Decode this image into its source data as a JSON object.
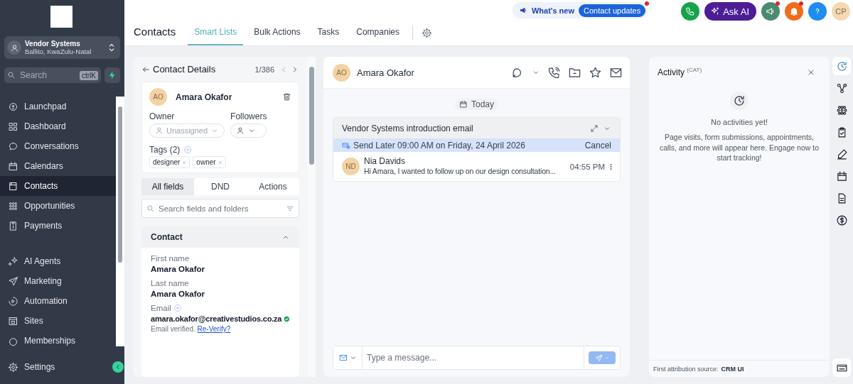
{
  "sidebar": {
    "account": {
      "name": "Vendor Systems",
      "location": "Ballito, KwaZulu-Natal"
    },
    "search": {
      "placeholder": "Search",
      "shortcut": "ctrlK"
    },
    "nav_groups": [
      [
        {
          "label": "Launchpad",
          "selected": false
        },
        {
          "label": "Dashboard",
          "selected": false
        },
        {
          "label": "Conversations",
          "selected": false
        },
        {
          "label": "Calendars",
          "selected": false
        },
        {
          "label": "Contacts",
          "selected": true
        },
        {
          "label": "Opportunities",
          "selected": false
        },
        {
          "label": "Payments",
          "selected": false
        }
      ],
      [
        {
          "label": "AI Agents",
          "selected": false
        },
        {
          "label": "Marketing",
          "selected": false
        },
        {
          "label": "Automation",
          "selected": false
        },
        {
          "label": "Sites",
          "selected": false
        },
        {
          "label": "Memberships",
          "selected": false
        }
      ]
    ],
    "settings": "Settings"
  },
  "header": {
    "title": "Contacts",
    "tabs": [
      {
        "label": "Smart Lists",
        "selected": true
      },
      {
        "label": "Bulk Actions",
        "selected": false
      },
      {
        "label": "Tasks",
        "selected": false
      },
      {
        "label": "Companies",
        "selected": false
      }
    ],
    "whats_new": {
      "label": "What's new",
      "button": "Contact updates",
      "badge": true
    },
    "actions": [
      {
        "kind": "phone",
        "badge": false
      },
      {
        "kind": "ask_ai",
        "label": "Ask AI",
        "badge": false
      },
      {
        "kind": "announcements",
        "badge": true
      },
      {
        "kind": "notifications",
        "badge": true
      },
      {
        "kind": "help",
        "badge": false
      },
      {
        "kind": "avatar",
        "label": "CP",
        "badge": false
      }
    ]
  },
  "contact_details": {
    "title": "Contact Details",
    "counter": "1/386",
    "contact": {
      "initials": "AO",
      "name": "Amara Okafor"
    },
    "owner": {
      "label": "Owner",
      "placeholder": "Unassigned"
    },
    "followers": {
      "label": "Followers"
    },
    "tags": {
      "title": "Tags (2)",
      "items": [
        "designer",
        "owner"
      ]
    },
    "tabs": [
      {
        "label": "All fields",
        "selected": true
      },
      {
        "label": "DND",
        "selected": false
      },
      {
        "label": "Actions",
        "selected": false
      }
    ],
    "search": {
      "placeholder": "Search fields and folders"
    },
    "section": {
      "title": "Contact",
      "expanded": true,
      "fields": [
        {
          "label": "First name",
          "value": "Amara Okafor"
        },
        {
          "label": "Last name",
          "value": "Amara Okafor"
        }
      ],
      "email": {
        "label": "Email",
        "value": "amara.okafor@creativestudios.co.za",
        "verified": true,
        "note": "Email verified.",
        "link": "Re-Verify?"
      }
    }
  },
  "conversation": {
    "contact": {
      "initials": "AO",
      "name": "Amara Okafor"
    },
    "date": "Today",
    "email": {
      "subject": "Vendor Systems introduction email",
      "schedule": "Send Later 09:00 AM on Friday, 24 April 2026",
      "cancel": "Cancel",
      "message": {
        "initials": "ND",
        "sender": "Nia Davids",
        "preview": "Hi Amara, I wanted to follow up on our design consultation...",
        "time": "04:55 PM"
      }
    },
    "composer": {
      "placeholder": "Type a message..."
    }
  },
  "activity": {
    "title": "Activity",
    "superscript": "(CAT)",
    "empty_title": "No activities yet!",
    "empty_text": "Page visits, form submissions, appointments, calls, and more will appear here. Engage now to start tracking!",
    "footer_label": "First attribution source:",
    "footer_value": "CRM UI"
  },
  "rail": [
    {
      "selected": true
    },
    {
      "selected": false
    },
    {
      "selected": false
    },
    {
      "selected": false
    },
    {
      "selected": false
    },
    {
      "selected": false
    },
    {
      "selected": false
    },
    {
      "selected": false
    }
  ]
}
